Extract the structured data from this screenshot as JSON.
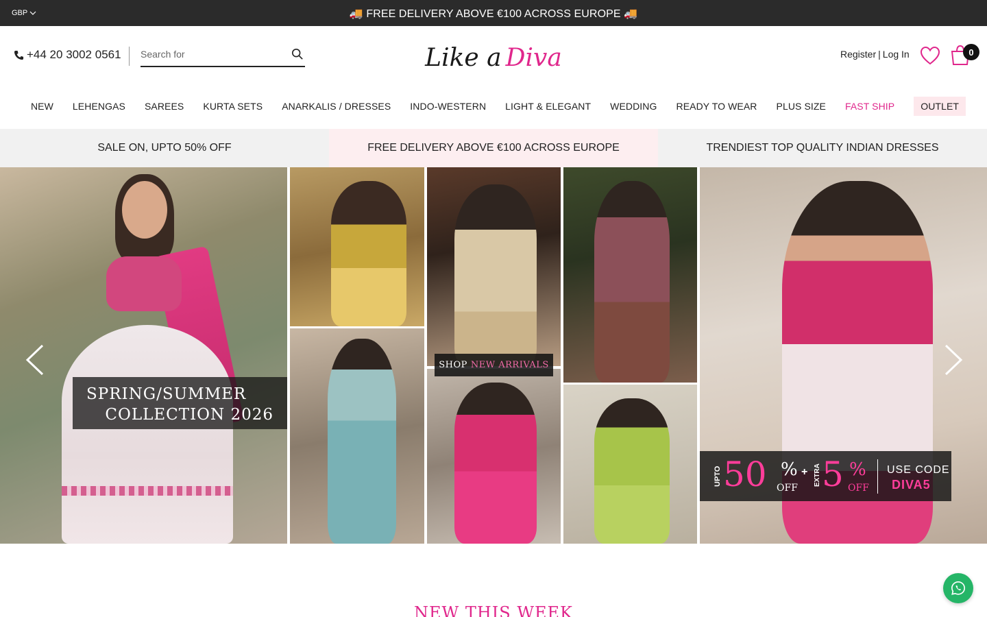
{
  "topbar": {
    "currency": "GBP",
    "announcement": "🚚 FREE DELIVERY ABOVE €100 ACROSS EUROPE 🚚"
  },
  "header": {
    "phone": "+44 20 3002 0561",
    "search_placeholder": "Search for",
    "logo_part1": "Like a",
    "logo_part2": "Diva",
    "register": "Register",
    "separator": "|",
    "login": "Log In",
    "cart_count": "0"
  },
  "nav": {
    "items": [
      {
        "label": "NEW"
      },
      {
        "label": "LEHENGAS"
      },
      {
        "label": "SAREES"
      },
      {
        "label": "KURTA SETS"
      },
      {
        "label": "ANARKALIS / DRESSES"
      },
      {
        "label": "INDO-WESTERN"
      },
      {
        "label": "LIGHT & ELEGANT"
      },
      {
        "label": "WEDDING"
      },
      {
        "label": "READY TO WEAR"
      },
      {
        "label": "PLUS SIZE"
      },
      {
        "label": "FAST SHIP"
      },
      {
        "label": "OUTLET"
      }
    ]
  },
  "usp": {
    "items": [
      {
        "label": "SALE ON, UPTO 50% OFF"
      },
      {
        "label": "FREE DELIVERY ABOVE €100 ACROSS EUROPE"
      },
      {
        "label": "TRENDIEST TOP QUALITY INDIAN DRESSES"
      }
    ]
  },
  "hero": {
    "collection_line1": "SPRING/SUMMER",
    "collection_line2": "COLLECTION 2026",
    "shop_label": "SHOP",
    "new_arrivals": "NEW ARRIVALS",
    "promo": {
      "upto": "UPTO",
      "discount1": "50",
      "percent1": "%",
      "off1": "OFF",
      "plus": "+",
      "extra": "EXTRA",
      "discount2": "5",
      "percent2": "%",
      "off2": "OFF",
      "use_code": "USE CODE",
      "code": "DIVA5"
    }
  },
  "section": {
    "title": "NEW THIS WEEK"
  },
  "colors": {
    "brand_pink": "#e0278c",
    "topbar_bg": "#2b2b2b",
    "whatsapp_green": "#25b567"
  }
}
